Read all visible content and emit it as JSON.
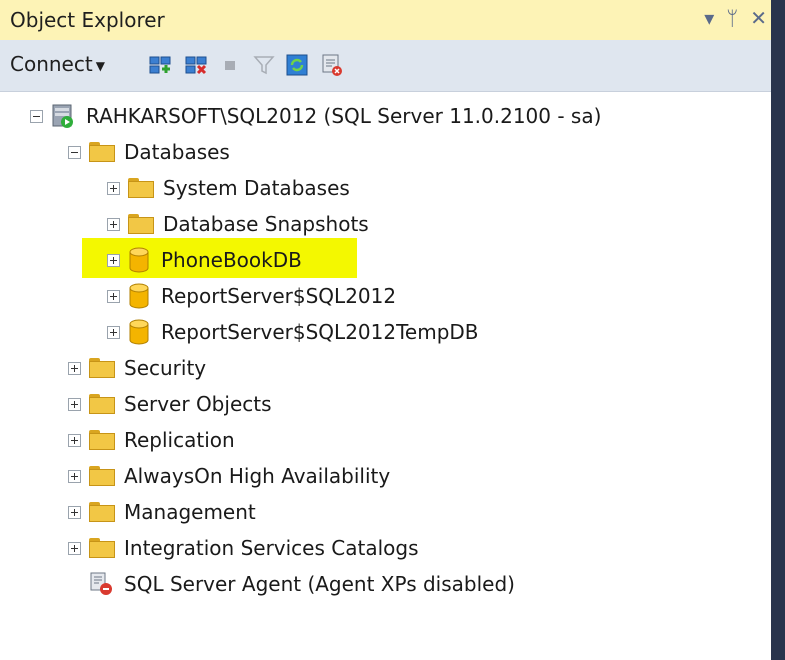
{
  "panel": {
    "title": "Object Explorer",
    "controls": {
      "dropdown": "▾",
      "pin": "ᛘ",
      "close": "✕"
    }
  },
  "toolbar": {
    "connect_label": "Connect",
    "buttons": [
      "connect-object-explorer-icon",
      "disconnect-icon",
      "stop-icon",
      "filter-icon",
      "refresh-icon",
      "activity-monitor-icon"
    ]
  },
  "tree": {
    "server": "RAHKARSOFT\\SQL2012 (SQL Server 11.0.2100 - sa)",
    "databases": {
      "label": "Databases",
      "children": [
        "System Databases",
        "Database Snapshots",
        "PhoneBookDB",
        "ReportServer$SQL2012",
        "ReportServer$SQL2012TempDB"
      ]
    },
    "folders": [
      "Security",
      "Server Objects",
      "Replication",
      "AlwaysOn High Availability",
      "Management",
      "Integration Services Catalogs"
    ],
    "agent": "SQL Server Agent (Agent XPs disabled)"
  },
  "colors": {
    "titlebar_bg": "#fdf3b6",
    "toolbar_bg": "#dfe6ef",
    "highlight": "#f4f800",
    "folder": "#f2c745",
    "database": "#f4b400"
  },
  "selection": {
    "highlighted_item": "PhoneBookDB"
  }
}
